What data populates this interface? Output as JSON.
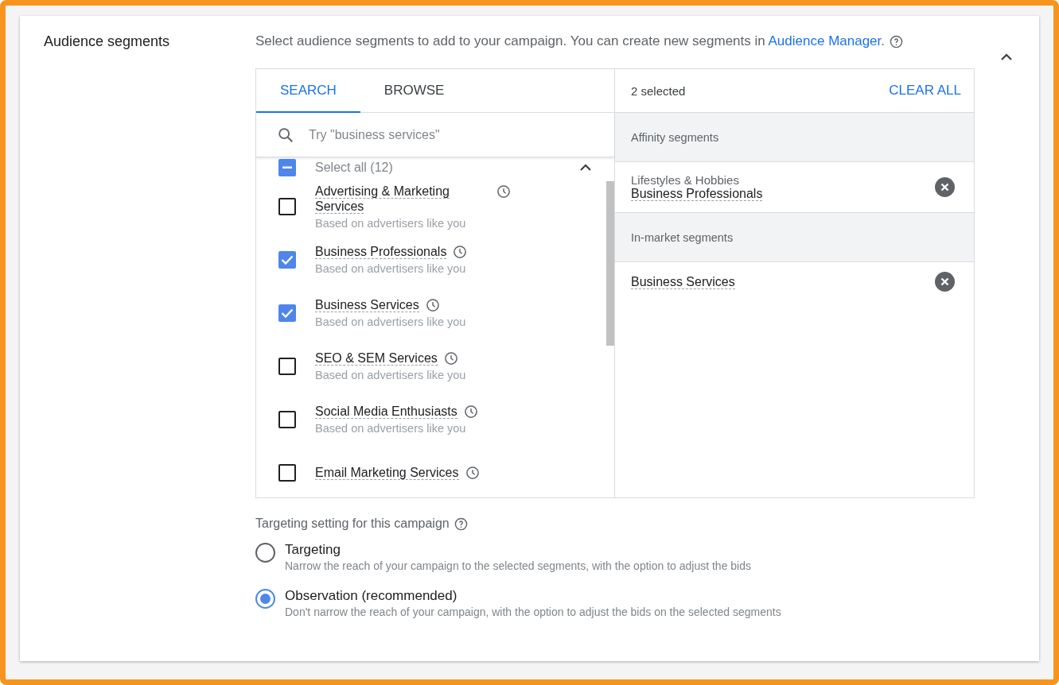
{
  "section": {
    "title": "Audience segments",
    "expanded": true,
    "description": "Select audience segments to add to your campaign. You can create new segments in ",
    "link": "Audience Manager",
    "description_end": "."
  },
  "tabs": [
    {
      "label": "SEARCH",
      "selected": true
    },
    {
      "label": "BROWSE",
      "selected": false
    }
  ],
  "search": {
    "placeholder": "Try \"business services\""
  },
  "select_all": {
    "label": "Select all (12)",
    "indeterminate": true,
    "expanded": true
  },
  "segments": [
    {
      "name": "Advertising & Marketing Services",
      "note": "Based on advertisers like you",
      "checked": false
    },
    {
      "name": "Business Professionals",
      "note": "Based on advertisers like you",
      "checked": true
    },
    {
      "name": "Business Services",
      "note": "Based on advertisers like you",
      "checked": true
    },
    {
      "name": "SEO & SEM Services",
      "note": "Based on advertisers like you",
      "checked": false
    },
    {
      "name": "Social Media Enthusiasts",
      "note": "Based on advertisers like you",
      "checked": false
    },
    {
      "name": "Email Marketing Services",
      "checked": false
    }
  ],
  "selection": {
    "count": "2 selected",
    "clear": "CLEAR ALL",
    "groups": [
      {
        "title": "Affinity segments",
        "items": [
          {
            "category": "Lifestyles & Hobbies",
            "name": "Business Professionals"
          }
        ]
      },
      {
        "title": "In-market segments",
        "items": [
          {
            "name": "Business Services"
          }
        ]
      }
    ]
  },
  "targeting": {
    "title": "Targeting setting for this campaign",
    "options": [
      {
        "label": "Targeting",
        "description": "Narrow the reach of your campaign to the selected segments, with the option to adjust the bids",
        "selected": false
      },
      {
        "label": "Observation (recommended)",
        "description": "Don't narrow the reach of your campaign, with the option to adjust the bids on the selected segments",
        "selected": true
      }
    ]
  }
}
